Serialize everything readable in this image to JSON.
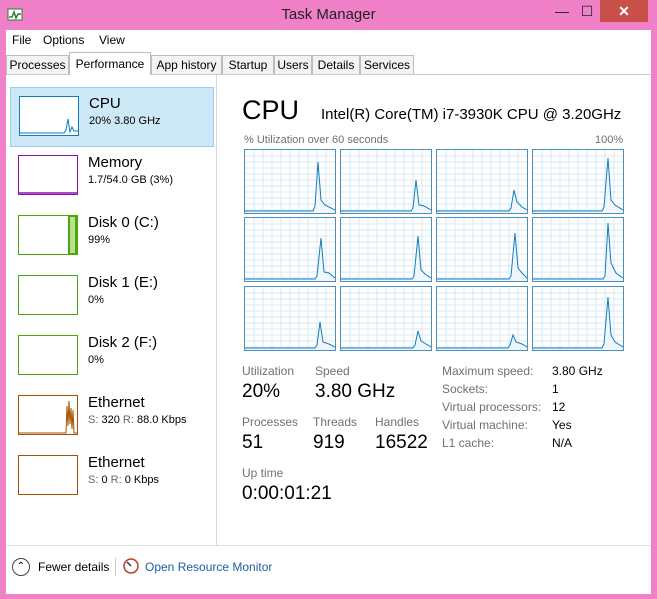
{
  "window": {
    "title": "Task Manager",
    "minimize_label": "—",
    "maximize_label": "☐",
    "close_label": "✕",
    "icon": "task-manager-icon"
  },
  "menu": [
    "File",
    "Options",
    "View"
  ],
  "tabs": [
    "Processes",
    "Performance",
    "App history",
    "Startup",
    "Users",
    "Details",
    "Services"
  ],
  "active_tab": "Performance",
  "sidebar": [
    {
      "name": "CPU",
      "value": "20% 3.80 GHz",
      "color": "#117dbb",
      "selected": true
    },
    {
      "name": "Memory",
      "value": "1.7/54.0 GB (3%)",
      "color": "#8b12ae"
    },
    {
      "name": "Disk 0 (C:)",
      "value": "99%",
      "color": "#4da60c"
    },
    {
      "name": "Disk 1 (E:)",
      "value": "0%",
      "color": "#4da60c"
    },
    {
      "name": "Disk 2 (F:)",
      "value": "0%",
      "color": "#4da60c"
    },
    {
      "name": "Ethernet",
      "value_s_label": "S:",
      "value_s": "320",
      "value_r_label": "R:",
      "value_r": "88.0 Kbps",
      "color": "#a74f01"
    },
    {
      "name": "Ethernet",
      "value_s_label": "S:",
      "value_s": "0",
      "value_r_label": "R:",
      "value_r": "0 Kbps",
      "color": "#a74f01"
    }
  ],
  "cpu": {
    "title": "CPU",
    "model": "Intel(R) Core(TM) i7-3930K CPU @ 3.20GHz",
    "util_label": "% Utilization over 60 seconds",
    "util_max": "100%",
    "graph_color": "#117dbb"
  },
  "stats": {
    "utilization_label": "Utilization",
    "utilization": "20%",
    "speed_label": "Speed",
    "speed": "3.80 GHz",
    "processes_label": "Processes",
    "processes": "51",
    "threads_label": "Threads",
    "threads": "919",
    "handles_label": "Handles",
    "handles": "16522",
    "uptime_label": "Up time",
    "uptime": "0:00:01:21"
  },
  "details": [
    {
      "label": "Maximum speed:",
      "value": "3.80 GHz"
    },
    {
      "label": "Sockets:",
      "value": "1"
    },
    {
      "label": "Virtual processors:",
      "value": "12"
    },
    {
      "label": "Virtual machine:",
      "value": "Yes"
    },
    {
      "label": "L1 cache:",
      "value": "N/A"
    }
  ],
  "footer": {
    "fewer_details": "Fewer details",
    "open_resource_monitor": "Open Resource Monitor"
  }
}
